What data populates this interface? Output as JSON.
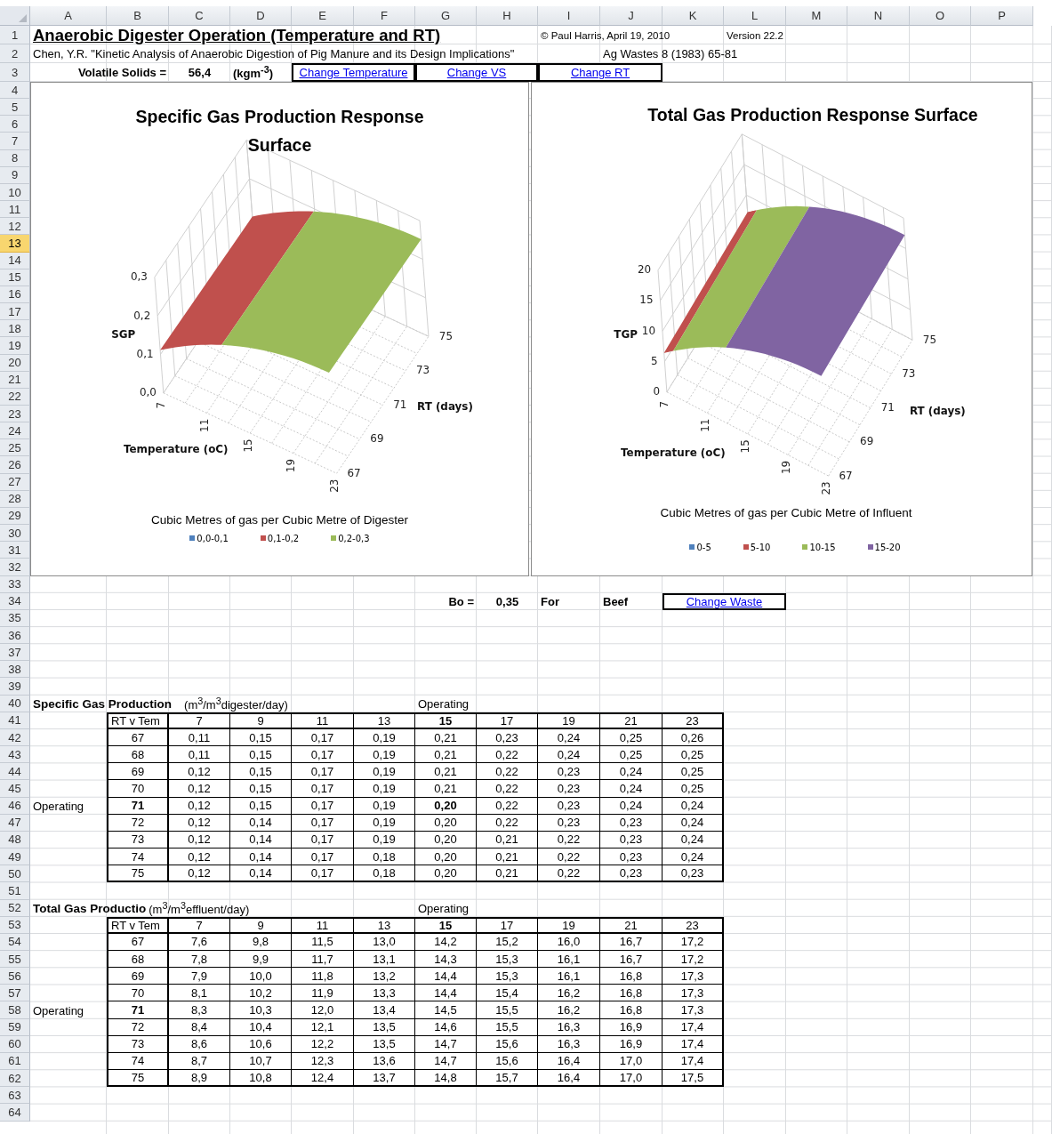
{
  "column_headers": [
    "A",
    "B",
    "C",
    "D",
    "E",
    "F",
    "G",
    "H",
    "I",
    "J",
    "K",
    "L",
    "M",
    "N",
    "O",
    "P"
  ],
  "row_headers": [
    {
      "label": "1",
      "selected": false
    },
    {
      "label": "2",
      "selected": false
    },
    {
      "label": "3",
      "selected": false
    },
    {
      "label": "4",
      "selected": false
    },
    {
      "label": "5",
      "selected": false
    },
    {
      "label": "6",
      "selected": false
    },
    {
      "label": "7",
      "selected": false
    },
    {
      "label": "8",
      "selected": false
    },
    {
      "label": "9",
      "selected": false
    },
    {
      "label": "10",
      "selected": false
    },
    {
      "label": "11",
      "selected": false
    },
    {
      "label": "12",
      "selected": false
    },
    {
      "label": "13",
      "selected": true
    },
    {
      "label": "14",
      "selected": false
    },
    {
      "label": "15",
      "selected": false
    },
    {
      "label": "16",
      "selected": false
    },
    {
      "label": "17",
      "selected": false
    },
    {
      "label": "18",
      "selected": false
    },
    {
      "label": "19",
      "selected": false
    },
    {
      "label": "20",
      "selected": false
    },
    {
      "label": "21",
      "selected": false
    },
    {
      "label": "22",
      "selected": false
    },
    {
      "label": "23",
      "selected": false
    },
    {
      "label": "24",
      "selected": false
    },
    {
      "label": "25",
      "selected": false
    },
    {
      "label": "26",
      "selected": false
    },
    {
      "label": "27",
      "selected": false
    },
    {
      "label": "28",
      "selected": false
    },
    {
      "label": "29",
      "selected": false
    },
    {
      "label": "30",
      "selected": false
    },
    {
      "label": "31",
      "selected": false
    },
    {
      "label": "32",
      "selected": false
    },
    {
      "label": "33",
      "selected": false
    },
    {
      "label": "34",
      "selected": false
    },
    {
      "label": "35",
      "selected": false
    },
    {
      "label": "36",
      "selected": false
    },
    {
      "label": "37",
      "selected": false
    },
    {
      "label": "38",
      "selected": false
    },
    {
      "label": "39",
      "selected": false
    },
    {
      "label": "40",
      "selected": false
    },
    {
      "label": "41",
      "selected": false
    },
    {
      "label": "42",
      "selected": false
    },
    {
      "label": "43",
      "selected": false
    },
    {
      "label": "44",
      "selected": false
    },
    {
      "label": "45",
      "selected": false
    },
    {
      "label": "46",
      "selected": false
    },
    {
      "label": "47",
      "selected": false
    },
    {
      "label": "48",
      "selected": false
    },
    {
      "label": "49",
      "selected": false
    },
    {
      "label": "50",
      "selected": false
    },
    {
      "label": "51",
      "selected": false
    },
    {
      "label": "52",
      "selected": false
    },
    {
      "label": "53",
      "selected": false
    },
    {
      "label": "54",
      "selected": false
    },
    {
      "label": "55",
      "selected": false
    },
    {
      "label": "56",
      "selected": false
    },
    {
      "label": "57",
      "selected": false
    },
    {
      "label": "58",
      "selected": false
    },
    {
      "label": "59",
      "selected": false
    },
    {
      "label": "60",
      "selected": false
    },
    {
      "label": "61",
      "selected": false
    },
    {
      "label": "62",
      "selected": false
    },
    {
      "label": "63",
      "selected": false
    },
    {
      "label": "64",
      "selected": false
    }
  ],
  "header": {
    "title": "Anaerobic Digester Operation (Temperature and RT)",
    "copyright": "© Paul Harris, April 19, 2010",
    "version": "Version 22.2",
    "citation": "Chen, Y.R. \"Kinetic Analysis of Anaerobic Digestion of Pig Manure and its Design Implications\"",
    "journal": "Ag Wastes 8 (1983) 65-81",
    "vs_label": "Volatile Solids =",
    "vs_value": "56,4",
    "vs_unit": "(kgm$^{-3}$)"
  },
  "links": [
    "Change Temperature",
    "Change VS",
    "Change RT"
  ],
  "charts": [
    {
      "title": "Specific Gas Production Response Surface",
      "z_label": "SGP",
      "z_ticks": [
        "0,3",
        "0,2",
        "0,1",
        "0,0"
      ],
      "x_label": "Temperature (oC)",
      "x_ticks": [
        "7",
        "11",
        "15",
        "19",
        "23"
      ],
      "y_label": "RT (days)",
      "y_ticks": [
        "67",
        "69",
        "71",
        "73",
        "75"
      ],
      "caption": "Cubic Metres of gas per Cubic Metre of Digester",
      "legend": [
        {
          "label": "0,0-0,1",
          "color": "#4f81bd"
        },
        {
          "label": "0,1-0,2",
          "color": "#c0504d"
        },
        {
          "label": "0,2-0,3",
          "color": "#9bbb59"
        }
      ]
    },
    {
      "title": "Total Gas Production Response Surface",
      "z_label": "TGP",
      "z_ticks": [
        "20",
        "15",
        "10",
        "5",
        "0"
      ],
      "x_label": "Temperature (oC)",
      "x_ticks": [
        "7",
        "11",
        "15",
        "19",
        "23"
      ],
      "y_label": "RT (days)",
      "y_ticks": [
        "67",
        "69",
        "71",
        "73",
        "75"
      ],
      "caption": "Cubic Metres of gas per Cubic Metre of Influent",
      "legend": [
        {
          "label": "0-5",
          "color": "#4f81bd"
        },
        {
          "label": "5-10",
          "color": "#c0504d"
        },
        {
          "label": "10-15",
          "color": "#9bbb59"
        },
        {
          "label": "15-20",
          "color": "#8064a2"
        }
      ]
    }
  ],
  "waste": {
    "bo_label": "Bo =",
    "bo_value": "0,35",
    "for_label": "For",
    "waste_name": "Beef",
    "link": "Change Waste"
  },
  "tables": [
    {
      "title": "Specific Gas Production",
      "unit": "(m$^{3}$/m$^{3}$digester/day)",
      "operating_label": "Operating",
      "corner": "RT v Tem",
      "emphasize_operating_value": true,
      "columns": [
        {
          "label": "7",
          "operating": false
        },
        {
          "label": "9",
          "operating": false
        },
        {
          "label": "11",
          "operating": false
        },
        {
          "label": "13",
          "operating": false
        },
        {
          "label": "15",
          "operating": true
        },
        {
          "label": "17",
          "operating": false
        },
        {
          "label": "19",
          "operating": false
        },
        {
          "label": "21",
          "operating": false
        },
        {
          "label": "23",
          "operating": false
        }
      ],
      "rows": [
        {
          "rt": "67",
          "operating": false,
          "values": [
            "0,11",
            "0,15",
            "0,17",
            "0,19",
            "0,21",
            "0,23",
            "0,24",
            "0,25",
            "0,26"
          ]
        },
        {
          "rt": "68",
          "operating": false,
          "values": [
            "0,11",
            "0,15",
            "0,17",
            "0,19",
            "0,21",
            "0,22",
            "0,24",
            "0,25",
            "0,25"
          ]
        },
        {
          "rt": "69",
          "operating": false,
          "values": [
            "0,12",
            "0,15",
            "0,17",
            "0,19",
            "0,21",
            "0,22",
            "0,23",
            "0,24",
            "0,25"
          ]
        },
        {
          "rt": "70",
          "operating": false,
          "values": [
            "0,12",
            "0,15",
            "0,17",
            "0,19",
            "0,21",
            "0,22",
            "0,23",
            "0,24",
            "0,25"
          ]
        },
        {
          "rt": "71",
          "operating": true,
          "note": "Operating",
          "values": [
            "0,12",
            "0,15",
            "0,17",
            "0,19",
            "0,20",
            "0,22",
            "0,23",
            "0,24",
            "0,24"
          ]
        },
        {
          "rt": "72",
          "operating": false,
          "values": [
            "0,12",
            "0,14",
            "0,17",
            "0,19",
            "0,20",
            "0,22",
            "0,23",
            "0,23",
            "0,24"
          ]
        },
        {
          "rt": "73",
          "operating": false,
          "values": [
            "0,12",
            "0,14",
            "0,17",
            "0,19",
            "0,20",
            "0,21",
            "0,22",
            "0,23",
            "0,24"
          ]
        },
        {
          "rt": "74",
          "operating": false,
          "values": [
            "0,12",
            "0,14",
            "0,17",
            "0,18",
            "0,20",
            "0,21",
            "0,22",
            "0,23",
            "0,24"
          ]
        },
        {
          "rt": "75",
          "operating": false,
          "values": [
            "0,12",
            "0,14",
            "0,17",
            "0,18",
            "0,20",
            "0,21",
            "0,22",
            "0,23",
            "0,23"
          ]
        }
      ]
    },
    {
      "title": "Total Gas Productio",
      "unit": "(m$^{3}$/m$^{3}$effluent/day)",
      "operating_label": "Operating",
      "corner": "RT v Tem",
      "emphasize_operating_value": false,
      "columns": [
        {
          "label": "7",
          "operating": false
        },
        {
          "label": "9",
          "operating": false
        },
        {
          "label": "11",
          "operating": false
        },
        {
          "label": "13",
          "operating": false
        },
        {
          "label": "15",
          "operating": true
        },
        {
          "label": "17",
          "operating": false
        },
        {
          "label": "19",
          "operating": false
        },
        {
          "label": "21",
          "operating": false
        },
        {
          "label": "23",
          "operating": false
        }
      ],
      "rows": [
        {
          "rt": "67",
          "operating": false,
          "values": [
            "7,6",
            "9,8",
            "11,5",
            "13,0",
            "14,2",
            "15,2",
            "16,0",
            "16,7",
            "17,2"
          ]
        },
        {
          "rt": "68",
          "operating": false,
          "values": [
            "7,8",
            "9,9",
            "11,7",
            "13,1",
            "14,3",
            "15,3",
            "16,1",
            "16,7",
            "17,2"
          ]
        },
        {
          "rt": "69",
          "operating": false,
          "values": [
            "7,9",
            "10,0",
            "11,8",
            "13,2",
            "14,4",
            "15,3",
            "16,1",
            "16,8",
            "17,3"
          ]
        },
        {
          "rt": "70",
          "operating": false,
          "values": [
            "8,1",
            "10,2",
            "11,9",
            "13,3",
            "14,4",
            "15,4",
            "16,2",
            "16,8",
            "17,3"
          ]
        },
        {
          "rt": "71",
          "operating": true,
          "note": "Operating",
          "values": [
            "8,3",
            "10,3",
            "12,0",
            "13,4",
            "14,5",
            "15,5",
            "16,2",
            "16,8",
            "17,3"
          ]
        },
        {
          "rt": "72",
          "operating": false,
          "values": [
            "8,4",
            "10,4",
            "12,1",
            "13,5",
            "14,6",
            "15,5",
            "16,3",
            "16,9",
            "17,4"
          ]
        },
        {
          "rt": "73",
          "operating": false,
          "values": [
            "8,6",
            "10,6",
            "12,2",
            "13,5",
            "14,7",
            "15,6",
            "16,3",
            "16,9",
            "17,4"
          ]
        },
        {
          "rt": "74",
          "operating": false,
          "values": [
            "8,7",
            "10,7",
            "12,3",
            "13,6",
            "14,7",
            "15,6",
            "16,4",
            "17,0",
            "17,4"
          ]
        },
        {
          "rt": "75",
          "operating": false,
          "values": [
            "8,9",
            "10,8",
            "12,4",
            "13,7",
            "14,8",
            "15,7",
            "16,4",
            "17,0",
            "17,5"
          ]
        }
      ]
    }
  ]
}
